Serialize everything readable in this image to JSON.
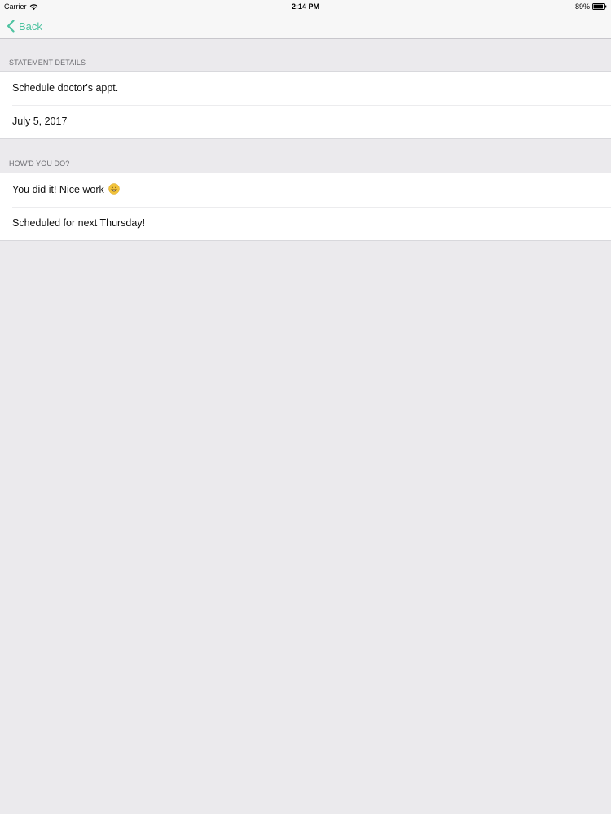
{
  "status_bar": {
    "carrier": "Carrier",
    "time": "2:14 PM",
    "battery": "89%",
    "battery_level": 0.89
  },
  "nav": {
    "back_label": "Back",
    "accent_color": "#4fc3a1"
  },
  "sections": [
    {
      "header": "STATEMENT DETAILS",
      "rows": [
        "Schedule doctor's appt.",
        "July 5, 2017"
      ]
    },
    {
      "header": "HOW'D YOU DO?",
      "rows": [
        "You did it! Nice work",
        "Scheduled for next Thursday!"
      ]
    }
  ],
  "icons": {
    "wifi": "wifi-icon",
    "battery": "battery-icon",
    "back": "chevron-left-icon",
    "emoji": "grinning-face-icon"
  }
}
